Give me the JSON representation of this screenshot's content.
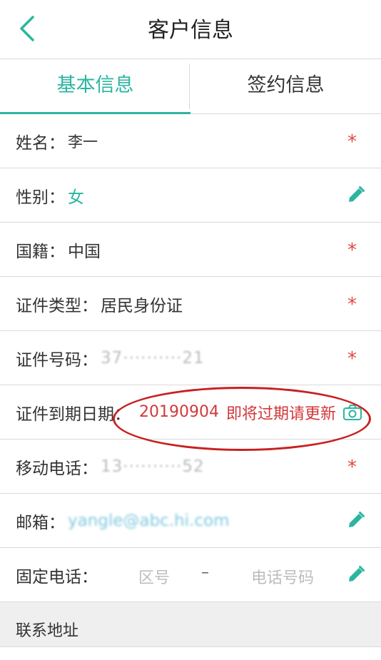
{
  "header": {
    "title": "客户信息",
    "back_icon": "chevron-left-icon"
  },
  "tabs": [
    {
      "label": "基本信息",
      "active": true
    },
    {
      "label": "签约信息",
      "active": false
    }
  ],
  "rows": {
    "name": {
      "label": "姓名：",
      "value": "李一",
      "required": "*"
    },
    "gender": {
      "label": "性别：",
      "value": "女",
      "icon": "edit-icon"
    },
    "nationality": {
      "label": "国籍：",
      "value": "中国",
      "required": "*"
    },
    "id_type": {
      "label": "证件类型：",
      "value": "居民身份证",
      "required": "*"
    },
    "id_number": {
      "label": "证件号码：",
      "value": "37··········21",
      "required": "*"
    },
    "id_expiry": {
      "label": "证件到期日期：",
      "value": "20190904",
      "notice": "即将过期请更新",
      "icon": "camera-icon"
    },
    "mobile": {
      "label": "移动电话：",
      "value": "13··········52",
      "required": "*"
    },
    "email": {
      "label": "邮箱：",
      "value": "yangle@abc.hi.com",
      "icon": "edit-icon"
    },
    "landline": {
      "label": "固定电话：",
      "area_placeholder": "区号",
      "separator": "–",
      "number_placeholder": "电话号码",
      "icon": "edit-icon"
    }
  },
  "section": {
    "label": "联系地址"
  },
  "colors": {
    "accent": "#2bb5a0",
    "required": "#e0483f",
    "alert": "#d2383a"
  }
}
